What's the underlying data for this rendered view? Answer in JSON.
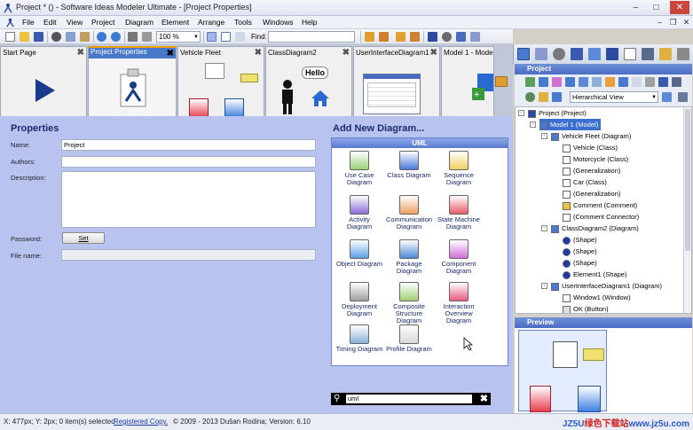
{
  "window": {
    "title": "Project * () - Software Ideas Modeler Ultimate - [Project Properties]"
  },
  "menu": [
    "File",
    "Edit",
    "View",
    "Project",
    "Diagram",
    "Element",
    "Arrange",
    "Tools",
    "Windows",
    "Help"
  ],
  "toolbar": {
    "zoom": "100 %",
    "find_label": "Find:",
    "find_value": ""
  },
  "tabs": [
    {
      "label": "Start Page",
      "active": false
    },
    {
      "label": "Project Properties",
      "active": true
    },
    {
      "label": "Vehicle Fleet",
      "active": false
    },
    {
      "label": "ClassDiagram2",
      "active": false
    },
    {
      "label": "UserInterfaceDiagram1",
      "active": false
    },
    {
      "label": "Model 1 - Model",
      "active": false
    }
  ],
  "tab_thumb_text": {
    "hello": "Hello"
  },
  "properties": {
    "title": "Properties",
    "name_label": "Name:",
    "name_value": "Project",
    "authors_label": "Authors:",
    "authors_value": "",
    "description_label": "Description:",
    "description_value": "",
    "password_label": "Password:",
    "set_button": "Set",
    "filename_label": "File name:",
    "filename_value": ""
  },
  "add_diagram": {
    "title": "Add New Diagram...",
    "category": "UML",
    "items": [
      {
        "label": "Use Case Diagram",
        "icon": "use-case-diagram-icon",
        "color": "#9ad07a"
      },
      {
        "label": "Class Diagram",
        "icon": "class-diagram-icon",
        "color": "#4a7ad8"
      },
      {
        "label": "Sequence Diagram",
        "icon": "sequence-diagram-icon",
        "color": "#f0d060"
      },
      {
        "label": "Activity Diagram",
        "icon": "activity-diagram-icon",
        "color": "#8a6ad8"
      },
      {
        "label": "Communication Diagram",
        "icon": "communication-diagram-icon",
        "color": "#f0a060"
      },
      {
        "label": "State Machine Diagram",
        "icon": "state-machine-diagram-icon",
        "color": "#e85a6a"
      },
      {
        "label": "Object Diagram",
        "icon": "object-diagram-icon",
        "color": "#5aa0e8"
      },
      {
        "label": "Package Diagram",
        "icon": "package-diagram-icon",
        "color": "#4a8ad8"
      },
      {
        "label": "Component Diagram",
        "icon": "component-diagram-icon",
        "color": "#d070d8"
      },
      {
        "label": "Deployment Diagram",
        "icon": "deployment-diagram-icon",
        "color": "#a0a0a0"
      },
      {
        "label": "Composite Structure Diagram",
        "icon": "composite-structure-diagram-icon",
        "color": "#a0d070"
      },
      {
        "label": "Interaction Overview Diagram",
        "icon": "interaction-overview-diagram-icon",
        "color": "#e85a7a"
      },
      {
        "label": "Timing Diagram",
        "icon": "timing-diagram-icon",
        "color": "#8ab0d8"
      },
      {
        "label": "Profile Diagram",
        "icon": "profile-diagram-icon",
        "color": "#d8d8d8"
      }
    ],
    "search_value": "uml"
  },
  "project_panel": {
    "title": "Project",
    "view_mode": "Hierarchical View",
    "tree": [
      {
        "label": "Project (Project)",
        "level": 0,
        "icon": "project-icon",
        "selected": false,
        "expander": "-"
      },
      {
        "label": "Model 1 (Model)",
        "level": 1,
        "icon": "model-icon",
        "selected": true,
        "expander": "-"
      },
      {
        "label": "Vehicle Fleet (Diagram)",
        "level": 2,
        "icon": "diagram-icon",
        "selected": false,
        "expander": "-"
      },
      {
        "label": "Vehicle (Class)",
        "level": 3,
        "icon": "class-icon",
        "selected": false
      },
      {
        "label": "Motorcycle (Class)",
        "level": 3,
        "icon": "class-icon",
        "selected": false
      },
      {
        "label": "(Generalization)",
        "level": 3,
        "icon": "generalization-icon",
        "selected": false
      },
      {
        "label": "Car (Class)",
        "level": 3,
        "icon": "class-icon",
        "selected": false
      },
      {
        "label": "(Generalization)",
        "level": 3,
        "icon": "generalization-icon",
        "selected": false
      },
      {
        "label": "Comment (Comment)",
        "level": 3,
        "icon": "comment-icon",
        "selected": false
      },
      {
        "label": "(Comment Connector)",
        "level": 3,
        "icon": "connector-icon",
        "selected": false
      },
      {
        "label": "ClassDiagram2 (Diagram)",
        "level": 2,
        "icon": "diagram-icon",
        "selected": false,
        "expander": "-"
      },
      {
        "label": "(Shape)",
        "level": 3,
        "icon": "shape-icon",
        "selected": false
      },
      {
        "label": "(Shape)",
        "level": 3,
        "icon": "shape-icon",
        "selected": false
      },
      {
        "label": "(Shape)",
        "level": 3,
        "icon": "shape-icon",
        "selected": false
      },
      {
        "label": "Element1 (Shape)",
        "level": 3,
        "icon": "shape-icon",
        "selected": false
      },
      {
        "label": "UserInterfaceDiagram1 (Diagram)",
        "level": 2,
        "icon": "diagram-icon",
        "selected": false,
        "expander": "-"
      },
      {
        "label": "Window1 (Window)",
        "level": 3,
        "icon": "window-icon",
        "selected": false
      },
      {
        "label": "OK (Button)",
        "level": 3,
        "icon": "button-icon",
        "selected": false
      }
    ]
  },
  "preview_panel": {
    "title": "Preview"
  },
  "status": {
    "coords": "X: 477px; Y: 2px; 0 item(s) selected",
    "registered": "Registered Copy.",
    "copyright": "© 2009 - 2013 Dušan Rodina; Version: 6.10",
    "watermark_a": "JZ5U",
    "watermark_b": "绿色下载站",
    "watermark_c": "www.jz5u.com"
  }
}
